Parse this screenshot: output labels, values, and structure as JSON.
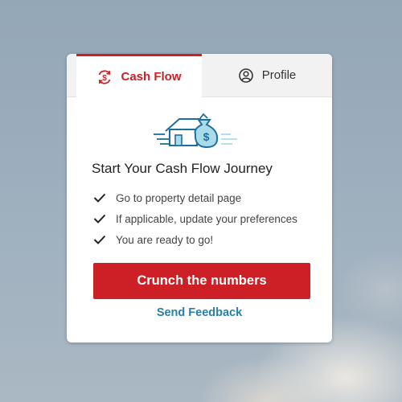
{
  "tabs": [
    {
      "label": "Cash Flow",
      "icon": "cash-flow-icon",
      "active": true
    },
    {
      "label": "Profile",
      "icon": "profile-icon",
      "active": false
    }
  ],
  "hero": {
    "icon": "house-money-bag-illustration"
  },
  "heading": "Start Your Cash Flow Journey",
  "checklist": [
    "Go to property detail page",
    "If applicable, update your preferences",
    "You are ready to go!"
  ],
  "cta_label": "Crunch the numbers",
  "feedback_label": "Send Feedback",
  "colors": {
    "accent": "#cd2026",
    "link": "#2a7fa6",
    "illustration": "#1f6f9e"
  }
}
